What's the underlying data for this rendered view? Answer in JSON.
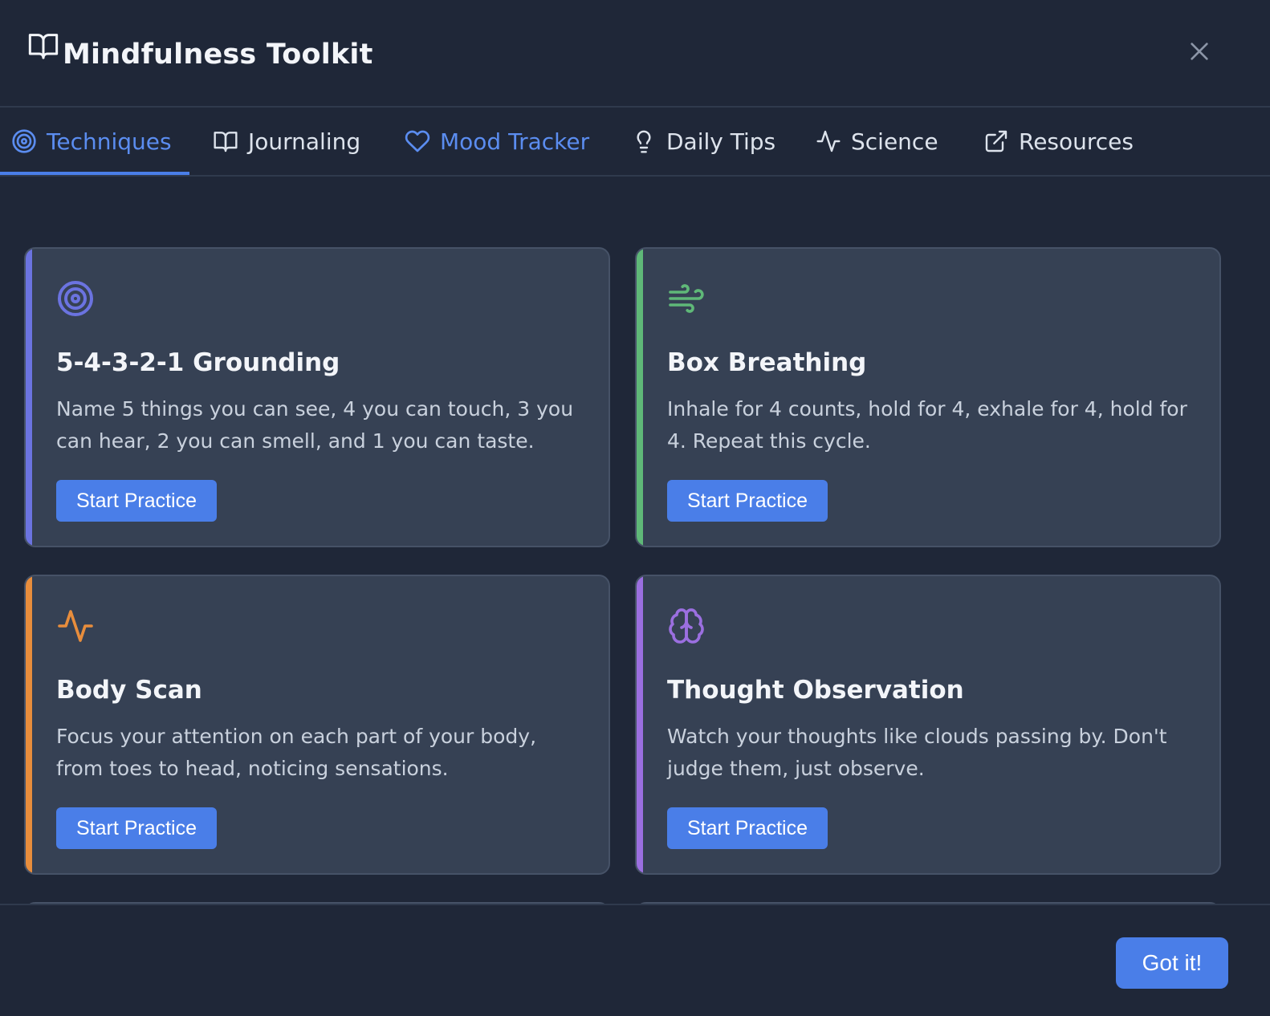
{
  "header": {
    "title": "Mindfulness Toolkit",
    "icon": "book-open-icon",
    "close_icon": "close-icon"
  },
  "tabs": [
    {
      "label": "Techniques",
      "icon": "target-icon",
      "active": true
    },
    {
      "label": "Journaling",
      "icon": "book-open-icon",
      "active": false
    },
    {
      "label": "Mood Tracker",
      "icon": "heart-icon",
      "active": false
    },
    {
      "label": "Daily Tips",
      "icon": "lightbulb-icon",
      "active": false
    },
    {
      "label": "Science",
      "icon": "activity-icon",
      "active": false
    },
    {
      "label": "Resources",
      "icon": "external-link-icon",
      "active": false
    }
  ],
  "cards": [
    {
      "title": "5-4-3-2-1 Grounding",
      "description": "Name 5 things you can see, 4 you can touch, 3 you can hear, 2 you can smell, and 1 you can taste.",
      "button": "Start Practice",
      "icon": "target-icon",
      "accent": "#6b73e0"
    },
    {
      "title": "Box Breathing",
      "description": "Inhale for 4 counts, hold for 4, exhale for 4, hold for 4. Repeat this cycle.",
      "button": "Start Practice",
      "icon": "wind-icon",
      "accent": "#5fb878"
    },
    {
      "title": "Body Scan",
      "description": "Focus your attention on each part of your body, from toes to head, noticing sensations.",
      "button": "Start Practice",
      "icon": "activity-icon",
      "accent": "#e88d3c"
    },
    {
      "title": "Thought Observation",
      "description": "Watch your thoughts like clouds passing by. Don't judge them, just observe.",
      "button": "Start Practice",
      "icon": "brain-icon",
      "accent": "#9b6fe0"
    }
  ],
  "footer": {
    "confirm_label": "Got it!"
  },
  "colors": {
    "background": "#1f2738",
    "card": "#364154",
    "primary": "#4a7ee8",
    "active_tab": "#5b8df0"
  }
}
